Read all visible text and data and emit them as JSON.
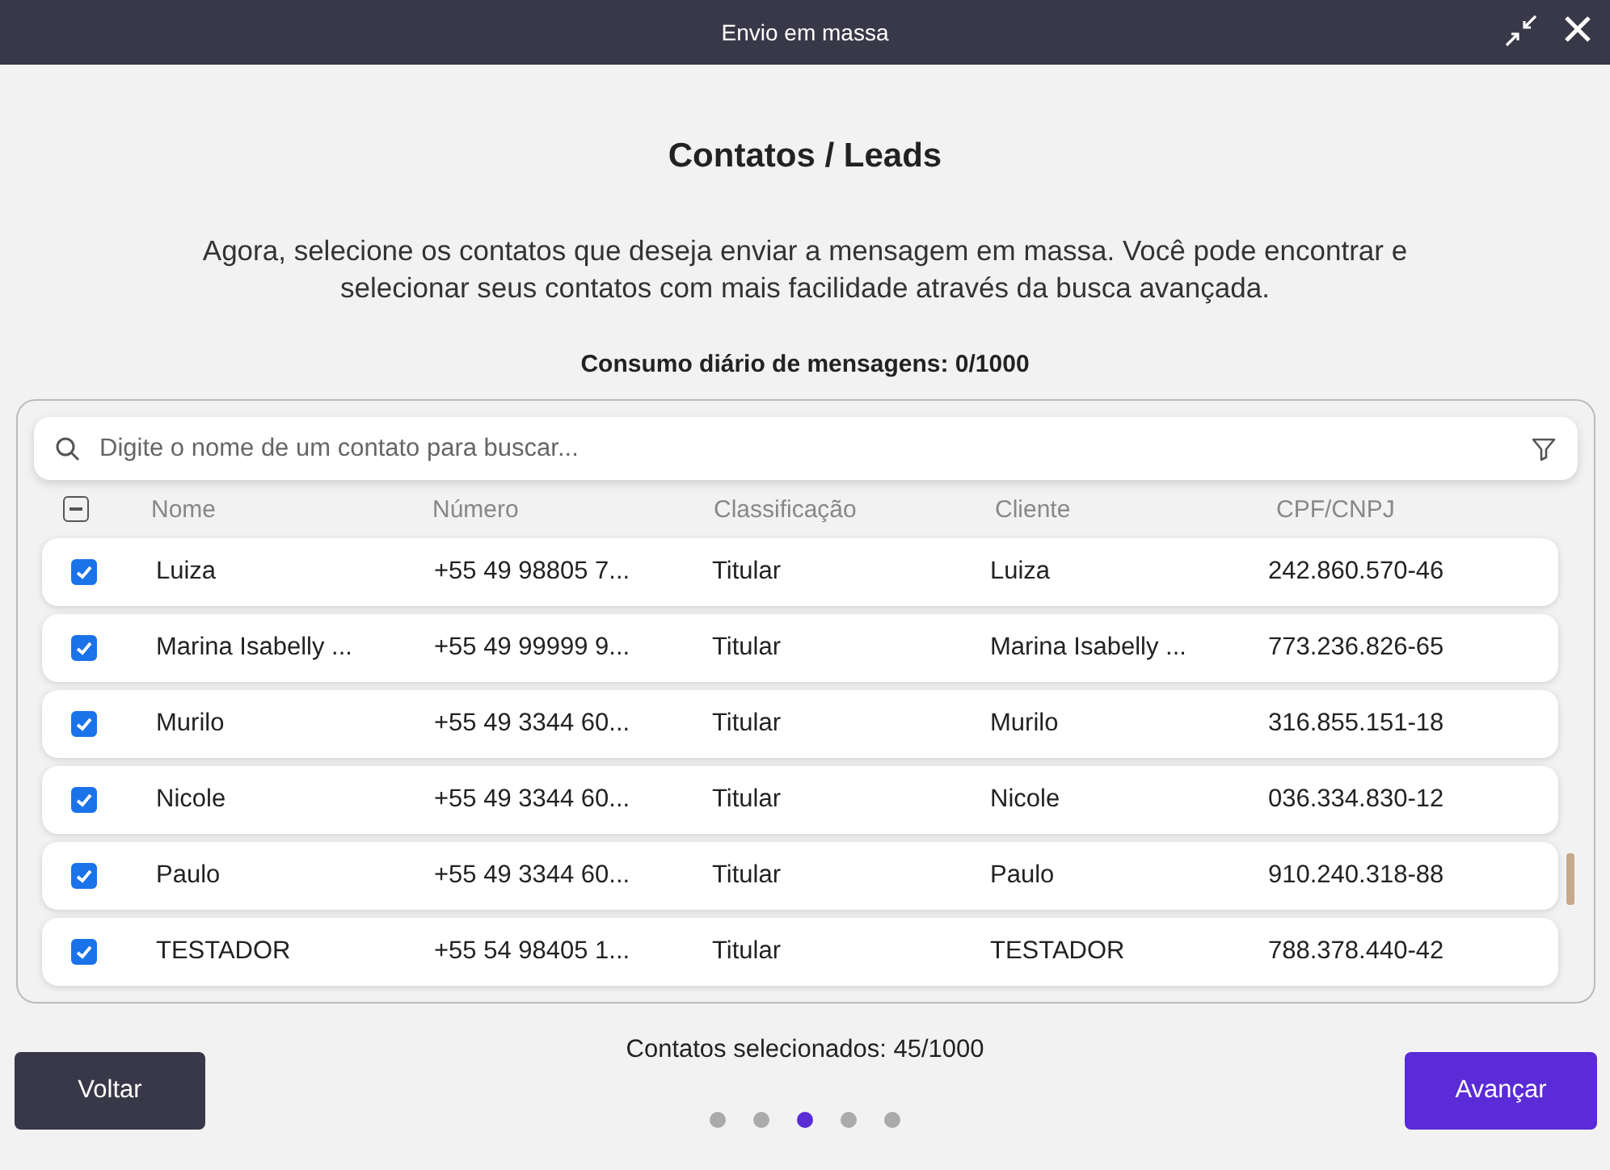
{
  "window": {
    "title": "Envio em massa"
  },
  "heading": "Contatos / Leads",
  "description": "Agora, selecione os contatos que deseja enviar a mensagem em massa. Você pode encontrar e selecionar seus contatos com mais facilidade através da busca avançada.",
  "daily_usage": "Consumo diário de mensagens: 0/1000",
  "search": {
    "placeholder": "Digite o nome de um contato para buscar..."
  },
  "table": {
    "select_all": {
      "indeterminate": true
    },
    "columns": [
      "Nome",
      "Número",
      "Classificação",
      "Cliente",
      "CPF/CNPJ"
    ],
    "rows": [
      {
        "checked": true,
        "cells": [
          "Luiza",
          "+55 49 98805 7...",
          "Titular",
          "Luiza",
          "242.860.570-46"
        ]
      },
      {
        "checked": true,
        "cells": [
          "Marina Isabelly ...",
          "+55 49 99999 9...",
          "Titular",
          "Marina Isabelly ...",
          "773.236.826-65"
        ]
      },
      {
        "checked": true,
        "cells": [
          "Murilo",
          "+55 49 3344 60...",
          "Titular",
          "Murilo",
          "316.855.151-18"
        ]
      },
      {
        "checked": true,
        "cells": [
          "Nicole",
          "+55 49 3344 60...",
          "Titular",
          "Nicole",
          "036.334.830-12"
        ]
      },
      {
        "checked": true,
        "cells": [
          "Paulo",
          "+55 49 3344 60...",
          "Titular",
          "Paulo",
          "910.240.318-88"
        ]
      },
      {
        "checked": true,
        "cells": [
          "TESTADOR",
          "+55 54 98405 1...",
          "Titular",
          "TESTADOR",
          "788.378.440-42"
        ]
      }
    ]
  },
  "selected_count": "Contatos selecionados: 45/1000",
  "steps": [
    {
      "selected": false
    },
    {
      "selected": false
    },
    {
      "selected": true
    },
    {
      "selected": false
    },
    {
      "selected": false
    }
  ],
  "buttons": {
    "back": "Voltar",
    "next": "Avançar"
  }
}
